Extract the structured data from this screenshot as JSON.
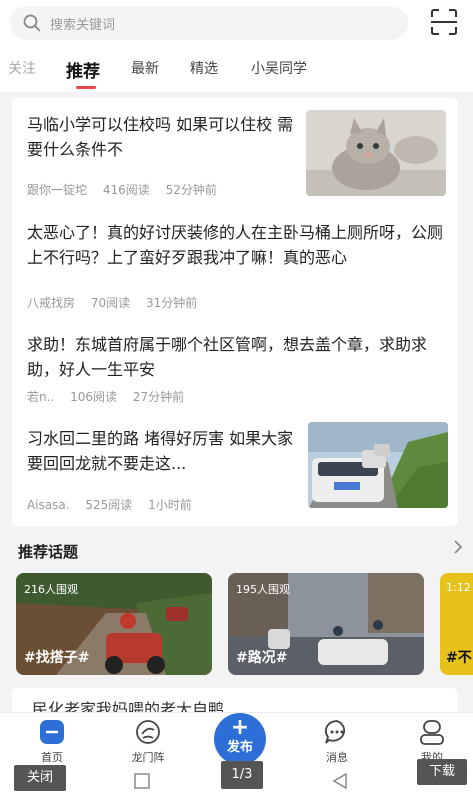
{
  "search": {
    "placeholder": "搜索关键词",
    "icon": "search-icon",
    "scan_icon": "scan-icon"
  },
  "tabs": [
    {
      "label": "关注",
      "active": false
    },
    {
      "label": "推荐",
      "active": true
    },
    {
      "label": "最新",
      "active": false
    },
    {
      "label": "精选",
      "active": false
    },
    {
      "label": "小吴同学",
      "active": false
    }
  ],
  "articles": [
    {
      "title": "马临小学可以住校吗 如果可以住校 需要什么条件不",
      "author": "跟你一锭坨",
      "reads": "416阅读",
      "time": "52分钟前",
      "thumb": "cat-photo"
    },
    {
      "title": "太恶心了！真的好讨厌装修的人在主卧马桶上厕所呀，公厕上不行吗？上了蛮好歹跟我冲了嘛！真的恶心",
      "author": "八戒找房",
      "reads": "70阅读",
      "time": "31分钟前",
      "thumb": null
    },
    {
      "title": "求助！东城首府属于哪个社区管啊，想去盖个章，求助求助，好人一生平安",
      "author": "若n..",
      "reads": "106阅读",
      "time": "27分钟前",
      "thumb": null
    },
    {
      "title": "习水回二里的路 堵得好厉害 如果大家要回回龙就不要走这...",
      "author": "Aisasa.",
      "reads": "525阅读",
      "time": "1小时前",
      "thumb": "traffic-photo"
    }
  ],
  "topics": {
    "header": "推荐话题",
    "items": [
      {
        "views": "216人围观",
        "tag": "#找搭子#"
      },
      {
        "views": "195人围观",
        "tag": "#路况#"
      },
      {
        "views": "1:12",
        "tag": "#不"
      }
    ]
  },
  "peek_text": "民化老家我妈喂的老大自鸭",
  "nav": {
    "home": "首页",
    "longmen": "龙门阵",
    "publish": "发布",
    "messages": "消息",
    "mine": "我的"
  },
  "system": {
    "close": "关闭",
    "page": "1/3",
    "download": "下载"
  },
  "colors": {
    "accent": "#e8464b",
    "brand": "#2d6fd6"
  }
}
